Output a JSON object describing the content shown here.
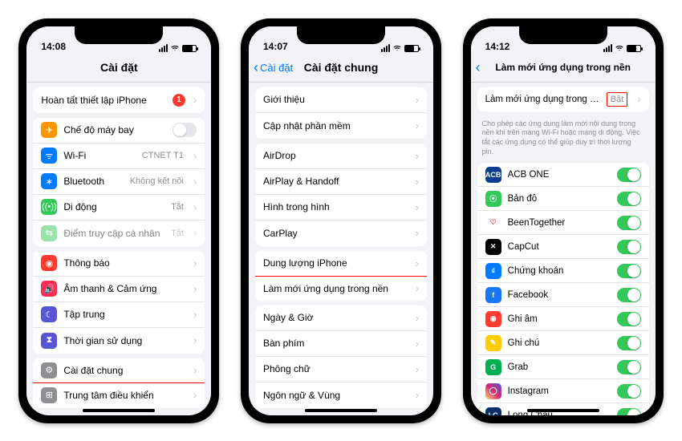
{
  "phone1": {
    "time": "14:08",
    "title": "Cài đặt",
    "setup": {
      "label": "Hoàn tất thiết lập iPhone",
      "badge": "1"
    },
    "rows": [
      {
        "icon_bg": "#ff9500",
        "glyph": "✈",
        "label": "Chế độ máy bay",
        "type": "toggle",
        "on": false
      },
      {
        "icon_bg": "#007aff",
        "glyph": "ᯤ",
        "label": "Wi-Fi",
        "value": "CTNET T1"
      },
      {
        "icon_bg": "#007aff",
        "glyph": "∗",
        "label": "Bluetooth",
        "value": "Không kết nối"
      },
      {
        "icon_bg": "#34c759",
        "glyph": "((•))",
        "label": "Di động",
        "value": "Tắt"
      },
      {
        "icon_bg": "#34c759",
        "glyph": "⇆",
        "label": "Điểm truy cập cá nhân",
        "value": "Tắt",
        "dim": true
      }
    ],
    "group2": [
      {
        "icon_bg": "#ff3b30",
        "glyph": "◉",
        "label": "Thông báo"
      },
      {
        "icon_bg": "#ff2d55",
        "glyph": "🔊",
        "label": "Âm thanh & Cảm ứng"
      },
      {
        "icon_bg": "#5856d6",
        "glyph": "☾",
        "label": "Tập trung"
      },
      {
        "icon_bg": "#5856d6",
        "glyph": "⧗",
        "label": "Thời gian sử dụng"
      }
    ],
    "group3": [
      {
        "icon_bg": "#8e8e93",
        "glyph": "⚙",
        "label": "Cài đặt chung",
        "hl": true
      },
      {
        "icon_bg": "#8e8e93",
        "glyph": "⊞",
        "label": "Trung tâm điều khiển"
      }
    ]
  },
  "phone2": {
    "time": "14:07",
    "back": "Cài đặt",
    "title": "Cài đặt chung",
    "g1": [
      {
        "label": "Giới thiệu"
      },
      {
        "label": "Cập nhật phần mềm"
      }
    ],
    "g2": [
      {
        "label": "AirDrop"
      },
      {
        "label": "AirPlay & Handoff"
      },
      {
        "label": "Hình trong hình"
      },
      {
        "label": "CarPlay"
      }
    ],
    "g3": [
      {
        "label": "Dung lượng iPhone"
      },
      {
        "label": "Làm mới ứng dụng trong nền",
        "hl": true
      }
    ],
    "g4": [
      {
        "label": "Ngày & Giờ"
      },
      {
        "label": "Bàn phím"
      },
      {
        "label": "Phông chữ"
      },
      {
        "label": "Ngôn ngữ & Vùng"
      }
    ]
  },
  "phone3": {
    "time": "14:12",
    "title": "Làm mới ứng dụng trong nền",
    "master": {
      "label": "Làm mới ứng dụng trong nền",
      "value": "Bật",
      "hl": true
    },
    "note": "Cho phép các ứng dụng làm mới nội dung trong nền khi trên mạng Wi-Fi hoặc mạng di động. Việc tắt các ứng dụng có thể giúp duy trì thời lượng pin.",
    "apps": [
      {
        "bg": "#0a3d91",
        "txt": "ACB",
        "label": "ACB ONE"
      },
      {
        "bg": "#34c759",
        "txt": "⦿",
        "label": "Bản đồ"
      },
      {
        "bg": "#ffffff",
        "txt": "♡",
        "fg": "#ff2d55",
        "label": "BeenTogether"
      },
      {
        "bg": "#000000",
        "txt": "✕",
        "label": "CapCut"
      },
      {
        "bg": "#007aff",
        "txt": "₫",
        "label": "Chứng khoán"
      },
      {
        "bg": "#1877f2",
        "txt": "f",
        "label": "Facebook"
      },
      {
        "bg": "#ff3b30",
        "txt": "◉",
        "label": "Ghi âm"
      },
      {
        "bg": "#ffcc00",
        "txt": "✎",
        "fg": "#fff",
        "label": "Ghi chú"
      },
      {
        "bg": "#00b14f",
        "txt": "G",
        "label": "Grab"
      },
      {
        "bg": "linear-gradient(45deg,#feda75,#d62976,#4f5bd5)",
        "txt": "◯",
        "label": "Instagram"
      },
      {
        "bg": "#0a2f6b",
        "txt": "LC",
        "label": "Long Châu"
      }
    ]
  }
}
